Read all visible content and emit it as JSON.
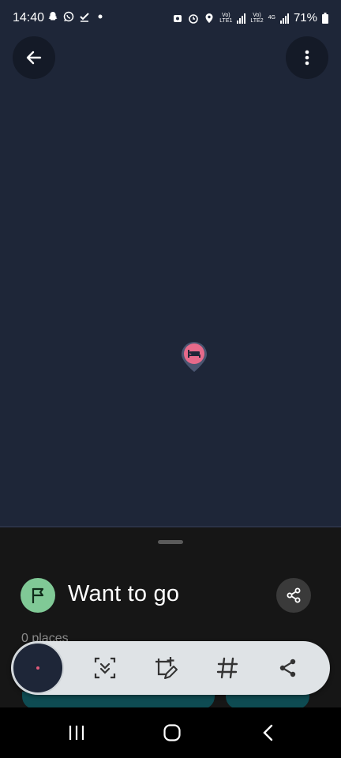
{
  "status_bar": {
    "time": "14:40",
    "battery": "71%",
    "net1_top": "Vo)",
    "net1_bottom": "LTE1",
    "net2_top": "Vo)",
    "net2_bottom": "LTE2",
    "net3_top": "4G",
    "left_icons": [
      "snapchat-icon",
      "whatsapp-icon",
      "check-icon",
      "dot-icon"
    ],
    "right_icons": [
      "privacy-icon",
      "alarm-icon",
      "location-icon"
    ]
  },
  "map": {
    "background": "#1e2638",
    "pin_color": "#e66a8a",
    "pin_icon": "hotel-bed-icon"
  },
  "sheet": {
    "title": "Want to go",
    "places_count": "0 places",
    "accent_green": "#80c996"
  },
  "toolbar": {
    "items": [
      "scroll-capture-icon",
      "edit-screenshot-icon",
      "hashtag-icon",
      "share-icon"
    ]
  },
  "navbar": {
    "items": [
      "recents-icon",
      "home-icon",
      "back-icon"
    ]
  }
}
